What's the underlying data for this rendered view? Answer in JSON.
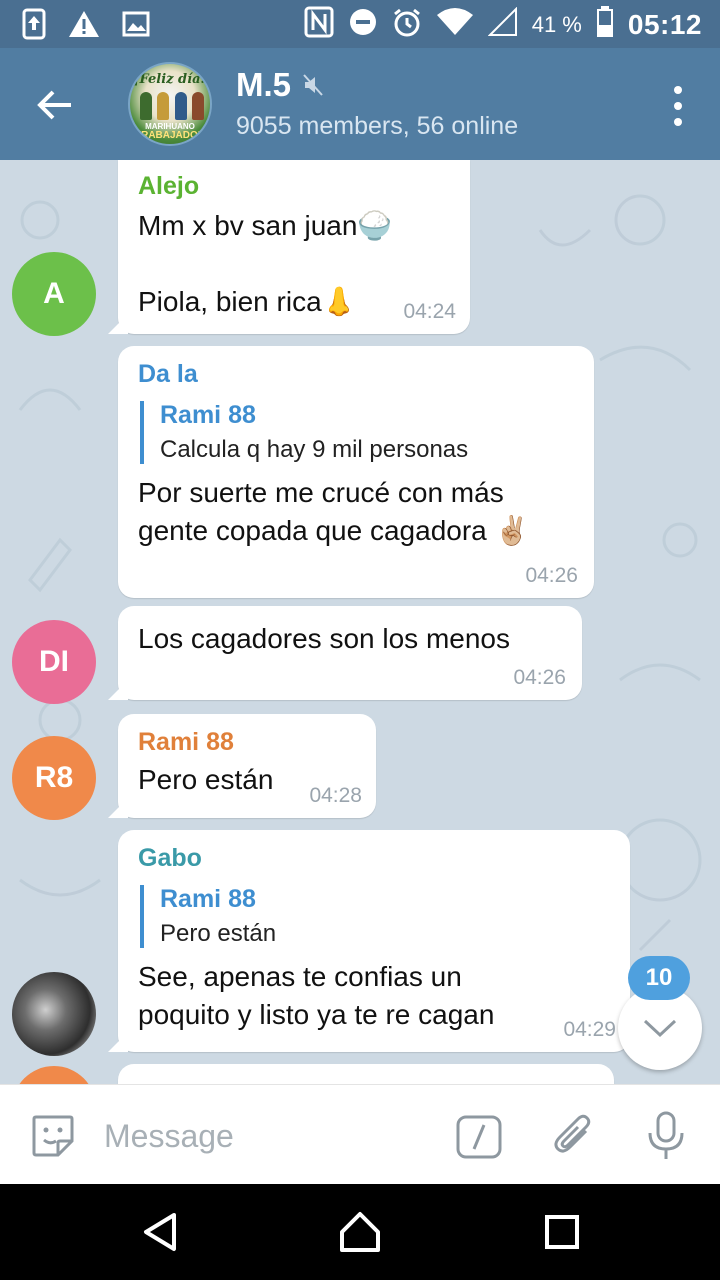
{
  "status_bar": {
    "battery_percent": "41 %",
    "time": "05:12"
  },
  "header": {
    "title": "M.5",
    "subtitle": "9055 members, 56 online",
    "avatar_text_top": "¡Feliz día!",
    "avatar_text_mid": "MARIHUANO",
    "avatar_text_bottom": "TRABAJADOR"
  },
  "messages": [
    {
      "sender": "Alejo",
      "line1": "Mm x bv san juan🍚",
      "line2": "Piola, bien rica👃",
      "time": "04:24",
      "avatar_initials": "A"
    },
    {
      "sender": "Da la",
      "quote_name": "Rami 88",
      "quote_text": "Calcula q hay 9 mil personas",
      "text1": "Por suerte me crucé con más",
      "text2": "gente copada que cagadora ✌🏼",
      "time": "04:26"
    },
    {
      "text": "Los cagadores son los menos",
      "time": "04:26",
      "avatar_initials": "DI"
    },
    {
      "sender": "Rami 88",
      "text": "Pero están",
      "time": "04:28",
      "avatar_initials": "R8"
    },
    {
      "sender": "Gabo",
      "quote_name": "Rami 88",
      "quote_text": "Pero están",
      "text1": "See, apenas te confias un",
      "text2": "poquito y listo ya te re cagan",
      "time": "04:29"
    }
  ],
  "scroll": {
    "unread_count": "10"
  },
  "composer": {
    "placeholder": "Message"
  },
  "colors": {
    "header_bg": "#517da2",
    "status_bg": "#4a6f91",
    "chat_bg": "#cdd9e3",
    "alejo_name": "#5bb332",
    "dala_name": "#3e8ed0",
    "rami_name": "#e0803a",
    "gabo_name": "#3a9aa8",
    "avatar_green": "#6cc04a",
    "avatar_pink": "#e96d96",
    "avatar_orange": "#f0894a",
    "badge_blue": "#4fa0de"
  }
}
